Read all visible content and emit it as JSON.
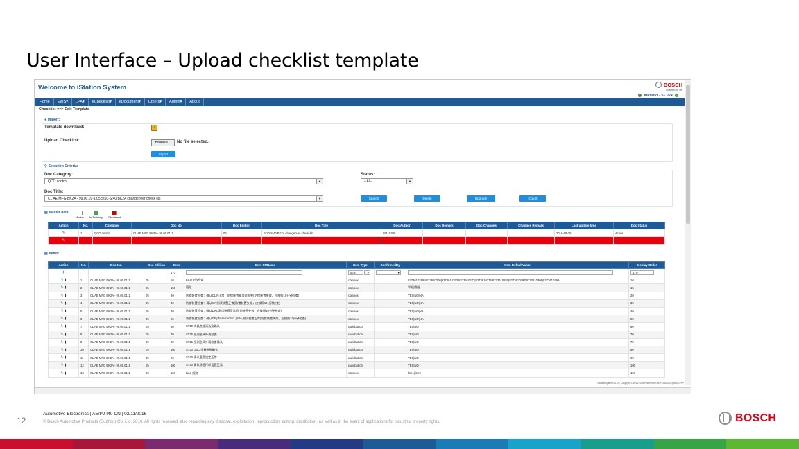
{
  "slide": {
    "title": "User Interface – Upload checklist template",
    "page_number": "12",
    "footer_info": "Automotive Electronics | AE/PJ-I40-CN | 02/11/2016",
    "footer_copyright": "© Bosch Automotive Products (Suzhou) Co. Ltd. 2016. All rights reserved, also regarding any disposal, exploitation, reproduction, editing, distribution, as well as in the event of applications for industrial property rights.",
    "logo_text": "BOSCH",
    "color_bar": [
      "#c8102e",
      "#a8163a",
      "#7b2a6e",
      "#4a2a7b",
      "#233a84",
      "#1e5b96",
      "#1a7bb6",
      "#18a3c8",
      "#189e8a",
      "#37a545",
      "#5cb832"
    ]
  },
  "app": {
    "title": "Welcome to iStation System",
    "brand": "BOSCH",
    "brand_tagline": "Invented for life",
    "user": "88924767 - Jia Jack",
    "nav": [
      "Home",
      "EWS▾",
      "LPA▾",
      "eChecklist▾",
      "eDocument▾",
      "Others▾",
      "Admin▾",
      "About"
    ],
    "breadcrumb": "Checklist ==> Edit Template",
    "footer": "iStation System v1.0.0, Copyright © 2014-2016 Powered by AE/PJ-I40-CN, @BOSCH™"
  },
  "import": {
    "header": "Import:",
    "template_download_label": "Template download:",
    "upload_label": "Upload Checklist:",
    "browse_label": "Browse...",
    "no_file_text": "No file selected.",
    "import_button": "Import"
  },
  "selection": {
    "header": "Selection Criteria:",
    "doc_category_label": "Doc Category:",
    "doc_category_value": "QCO control",
    "status_label": "Status:",
    "status_value": "--All--",
    "doc_title_label": "Doc Title:",
    "doc_title_value": "CL AE MFG BK2A - 99.00.01-1|05|St10-St40 BK2A changeover check list",
    "buttons": [
      "Search",
      "Delete",
      "Upgrade",
      "Export"
    ]
  },
  "master": {
    "header": "Master data:",
    "legend": [
      "Active",
      "In Training",
      "Obsoleted"
    ],
    "legend_colors": [
      "#ffffff",
      "#3aa845",
      "#d40000"
    ],
    "columns": [
      "Action",
      "No.",
      "Category",
      "Doc No.",
      "Doc Edition",
      "Doc Title",
      "Doc Author",
      "Doc Remark",
      "Doc Changes",
      "Changes Remark",
      "Last update time",
      "Doc Status"
    ],
    "rows": [
      [
        "1",
        "QCO control",
        "CL AE MFG BK2A - 99.00.01-1",
        "05",
        "St10-St40 BK2A changeover check list",
        "88119389",
        "",
        "",
        "",
        "2016-08-25",
        "Active"
      ]
    ]
  },
  "items": {
    "header": "Items:",
    "columns": [
      "Action",
      "No.",
      "Doc No.",
      "Doc Edition",
      "Item",
      "Item CNName",
      "Item Type",
      "ConfirmedBy",
      "Item DefaultValue",
      "Display Order"
    ],
    "new_row": {
      "item": "170",
      "type": "strin",
      "order": "170"
    },
    "rows": [
      [
        "1",
        "CL AE MFG BK2A - 99.00.01-1",
        "05",
        "10",
        "ECU P/N检查",
        "combox",
        "",
        "8273610299|8273610300|8273610253|8273610272|8273610275|8273610280|8273610297|8273610306|8273610299",
        "10"
      ],
      [
        "2",
        "CL AE MFG BK2A - 99.00.01-1",
        "05",
        "150",
        "班组",
        "combox",
        "",
        "早班|晚班",
        "15"
      ],
      [
        "3",
        "CL AE MFG BK2A - 99.00.01-1",
        "05",
        "20",
        "防错装置检查：确认CLIP正常，防错装置能及时报警(防错装置失效，应按照10分钟检查)",
        "combox",
        "",
        "YES|NO|NA",
        "20"
      ],
      [
        "4",
        "CL AE MFG BK2A - 99.00.01-1",
        "05",
        "30",
        "防错装置检查：确认ICT测试装置正常(防错装置失效，应按照10分钟检查)",
        "combox",
        "",
        "YES|NO|NA",
        "30"
      ],
      [
        "5",
        "CL AE MFG BK2A - 99.00.01-1",
        "05",
        "40",
        "防错装置检查：确认DRC测试装置正常(防错装置失效，应按照10分钟检查)",
        "combox",
        "",
        "YES|NO|NA",
        "40"
      ],
      [
        "6",
        "CL AE MFG BK2A - 99.00.01-1",
        "05",
        "50",
        "防错装置检查：确认GP,phase contact plate,测试装置正常(防错装置失效，应按照10分钟检查)",
        "combox",
        "",
        "YES|NO|NA",
        "50"
      ],
      [
        "7",
        "CL AE MFG BK2A - 99.00.01-1",
        "05",
        "60",
        "ST10 夹具底座清洁及确认",
        "radiobutton",
        "",
        "YES|NO",
        "60"
      ],
      [
        "8",
        "CL AE MFG BK2A - 99.00.01-1",
        "05",
        "70",
        "ST25 检测治具外观检查",
        "radiobutton",
        "",
        "YES|NO",
        "70"
      ],
      [
        "9",
        "CL AE MFG BK2A - 99.00.01-1",
        "05",
        "80",
        "ST25 检测治具外观检查确认",
        "radiobutton",
        "",
        "YES|NO",
        "75"
      ],
      [
        "10",
        "CL AE MFG BK2A - 99.00.01-1",
        "05",
        "100",
        "ST30 DBC 设备参数确认",
        "radiobutton",
        "",
        "YES|NO",
        "80"
      ],
      [
        "11",
        "CL AE MFG BK2A - 99.00.01-1",
        "05",
        "90",
        "ST40 确认温度设定正常",
        "radiobutton",
        "",
        "YES|NO",
        "90"
      ],
      [
        "12",
        "CL AE MFG BK2A - 99.00.01-1",
        "05",
        "100",
        "ST40 确认标签打印设置正常",
        "radiobutton",
        "",
        "YES|NO",
        "100"
      ],
      [
        "13",
        "CL AE MFG BK2A - 99.00.01-1",
        "05",
        "110",
        "Line 线别",
        "combox",
        "",
        "line1|line2",
        "110"
      ]
    ]
  }
}
